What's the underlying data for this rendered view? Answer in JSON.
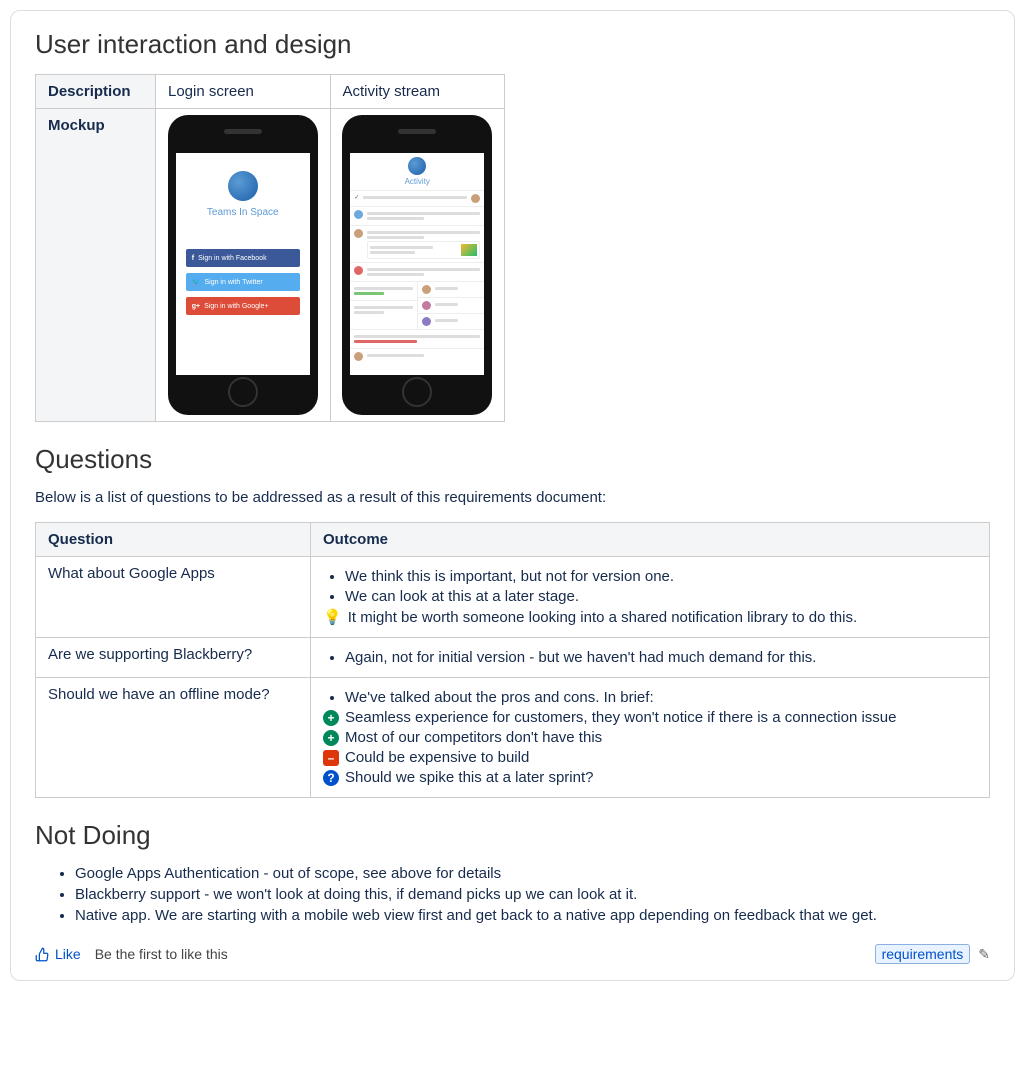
{
  "section1": {
    "title": "User interaction and design",
    "table": {
      "row1_header": "Description",
      "row1_col1": "Login screen",
      "row1_col2": "Activity stream",
      "row2_header": "Mockup"
    },
    "login_mock": {
      "brand": "Teams In Space",
      "fb": "Sign in with Facebook",
      "tw": "Sign in with Twitter",
      "gp": "Sign in with Google+"
    },
    "activity_mock": {
      "title": "Activity"
    }
  },
  "section2": {
    "title": "Questions",
    "intro": "Below is a list of questions to be addressed as a result of this requirements document:",
    "headers": {
      "q": "Question",
      "o": "Outcome"
    },
    "rows": [
      {
        "question": "What about Google Apps",
        "outcomes": [
          {
            "type": "bullet",
            "text": "We think this is important, but not for version one."
          },
          {
            "type": "bullet",
            "text": "We can look at this at a later stage."
          },
          {
            "type": "idea",
            "text": "It might be worth someone looking into a shared notification library to do this."
          }
        ]
      },
      {
        "question": "Are we supporting Blackberry?",
        "outcomes": [
          {
            "type": "bullet",
            "text": "Again, not for initial version - but we haven't had much demand for this."
          }
        ]
      },
      {
        "question": "Should we have an offline mode?",
        "outcomes": [
          {
            "type": "bullet",
            "text": "We've talked about the pros and cons. In brief:"
          },
          {
            "type": "plus",
            "text": "Seamless experience for customers, they won't notice if there is a connection issue"
          },
          {
            "type": "plus",
            "text": "Most of our competitors don't have this"
          },
          {
            "type": "minus",
            "text": "Could be expensive to build"
          },
          {
            "type": "question",
            "text": "Should we spike this at a later sprint?"
          }
        ]
      }
    ]
  },
  "section3": {
    "title": "Not Doing",
    "items": [
      "Google Apps Authentication - out of scope, see above for details",
      "Blackberry support - we won't look at doing this, if demand picks up we can look at it.",
      "Native app. We are starting with a mobile web view first and get back to a native app depending on feedback that we get."
    ]
  },
  "footer": {
    "like_label": "Like",
    "like_hint": "Be the first to like this",
    "tag": "requirements"
  }
}
